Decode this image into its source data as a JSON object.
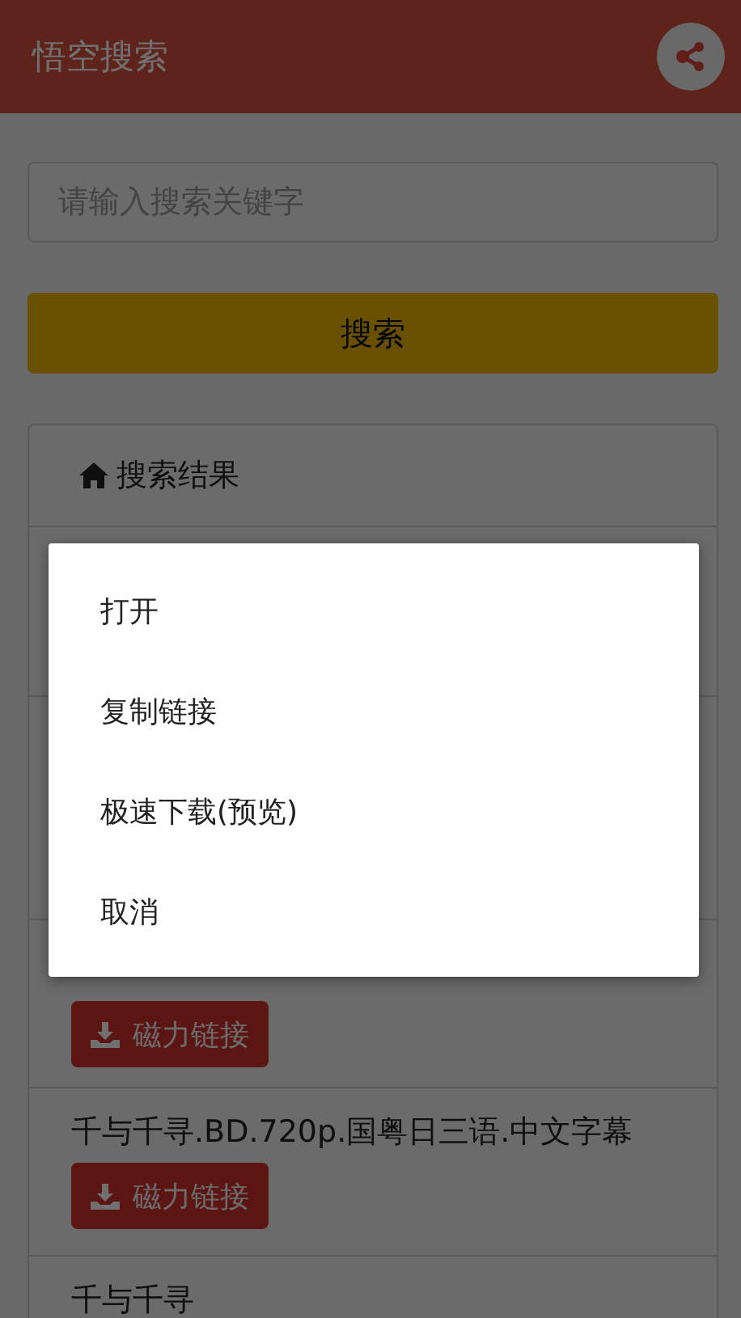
{
  "app_bar": {
    "title": "悟空搜索"
  },
  "search": {
    "placeholder": "请输入搜索关键字",
    "button": "搜索"
  },
  "results": {
    "heading": "搜索结果",
    "items": [
      {
        "link": "磁力链接"
      },
      {
        "title": "千与千寻.BD.720p.国粤日三语.中文字幕",
        "link": "磁力链接"
      },
      {
        "title": "千与千寻"
      }
    ]
  },
  "dialog": {
    "options": [
      "打开",
      "复制链接",
      "极速下载(预览)",
      "取消"
    ]
  }
}
